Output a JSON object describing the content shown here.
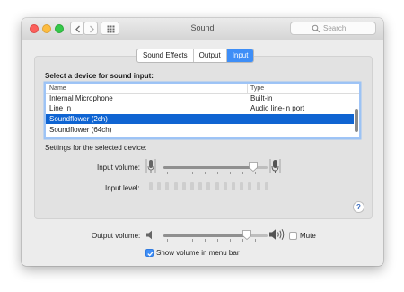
{
  "window": {
    "title": "Sound",
    "search_placeholder": "Search"
  },
  "tabs": [
    {
      "label": "Sound Effects",
      "active": false
    },
    {
      "label": "Output",
      "active": false
    },
    {
      "label": "Input",
      "active": true
    }
  ],
  "input": {
    "heading": "Select a device for sound input:",
    "columns": {
      "name": "Name",
      "type": "Type"
    },
    "devices": [
      {
        "name": "Internal Microphone",
        "type": "Built-in"
      },
      {
        "name": "Line In",
        "type": "Audio line-in port"
      },
      {
        "name": "Soundflower (2ch)",
        "type": ""
      },
      {
        "name": "Soundflower (64ch)",
        "type": ""
      }
    ],
    "selected_device": "Soundflower (2ch)",
    "settings_label": "Settings for the selected device:",
    "input_volume_label": "Input volume:",
    "input_volume_fraction": 0.86,
    "input_level_label": "Input level:",
    "input_level_active_bars": 0
  },
  "output": {
    "volume_label": "Output volume:",
    "volume_fraction": 0.8,
    "mute_label": "Mute",
    "mute_checked": false,
    "show_volume_label": "Show volume in menu bar",
    "show_volume_checked": true
  },
  "colors": {
    "accent": "#3e8ef7",
    "selection": "#0f64d2"
  },
  "icons": {
    "back": "chevron-left-icon",
    "forward": "chevron-right-icon",
    "grid": "grid-icon",
    "search": "magnifier-icon",
    "mic_low": "microphone-low-icon",
    "mic_high": "microphone-high-icon",
    "speaker_low": "speaker-low-icon",
    "speaker_high": "speaker-high-icon",
    "help": "question-mark-icon"
  },
  "help_button_label": "?"
}
